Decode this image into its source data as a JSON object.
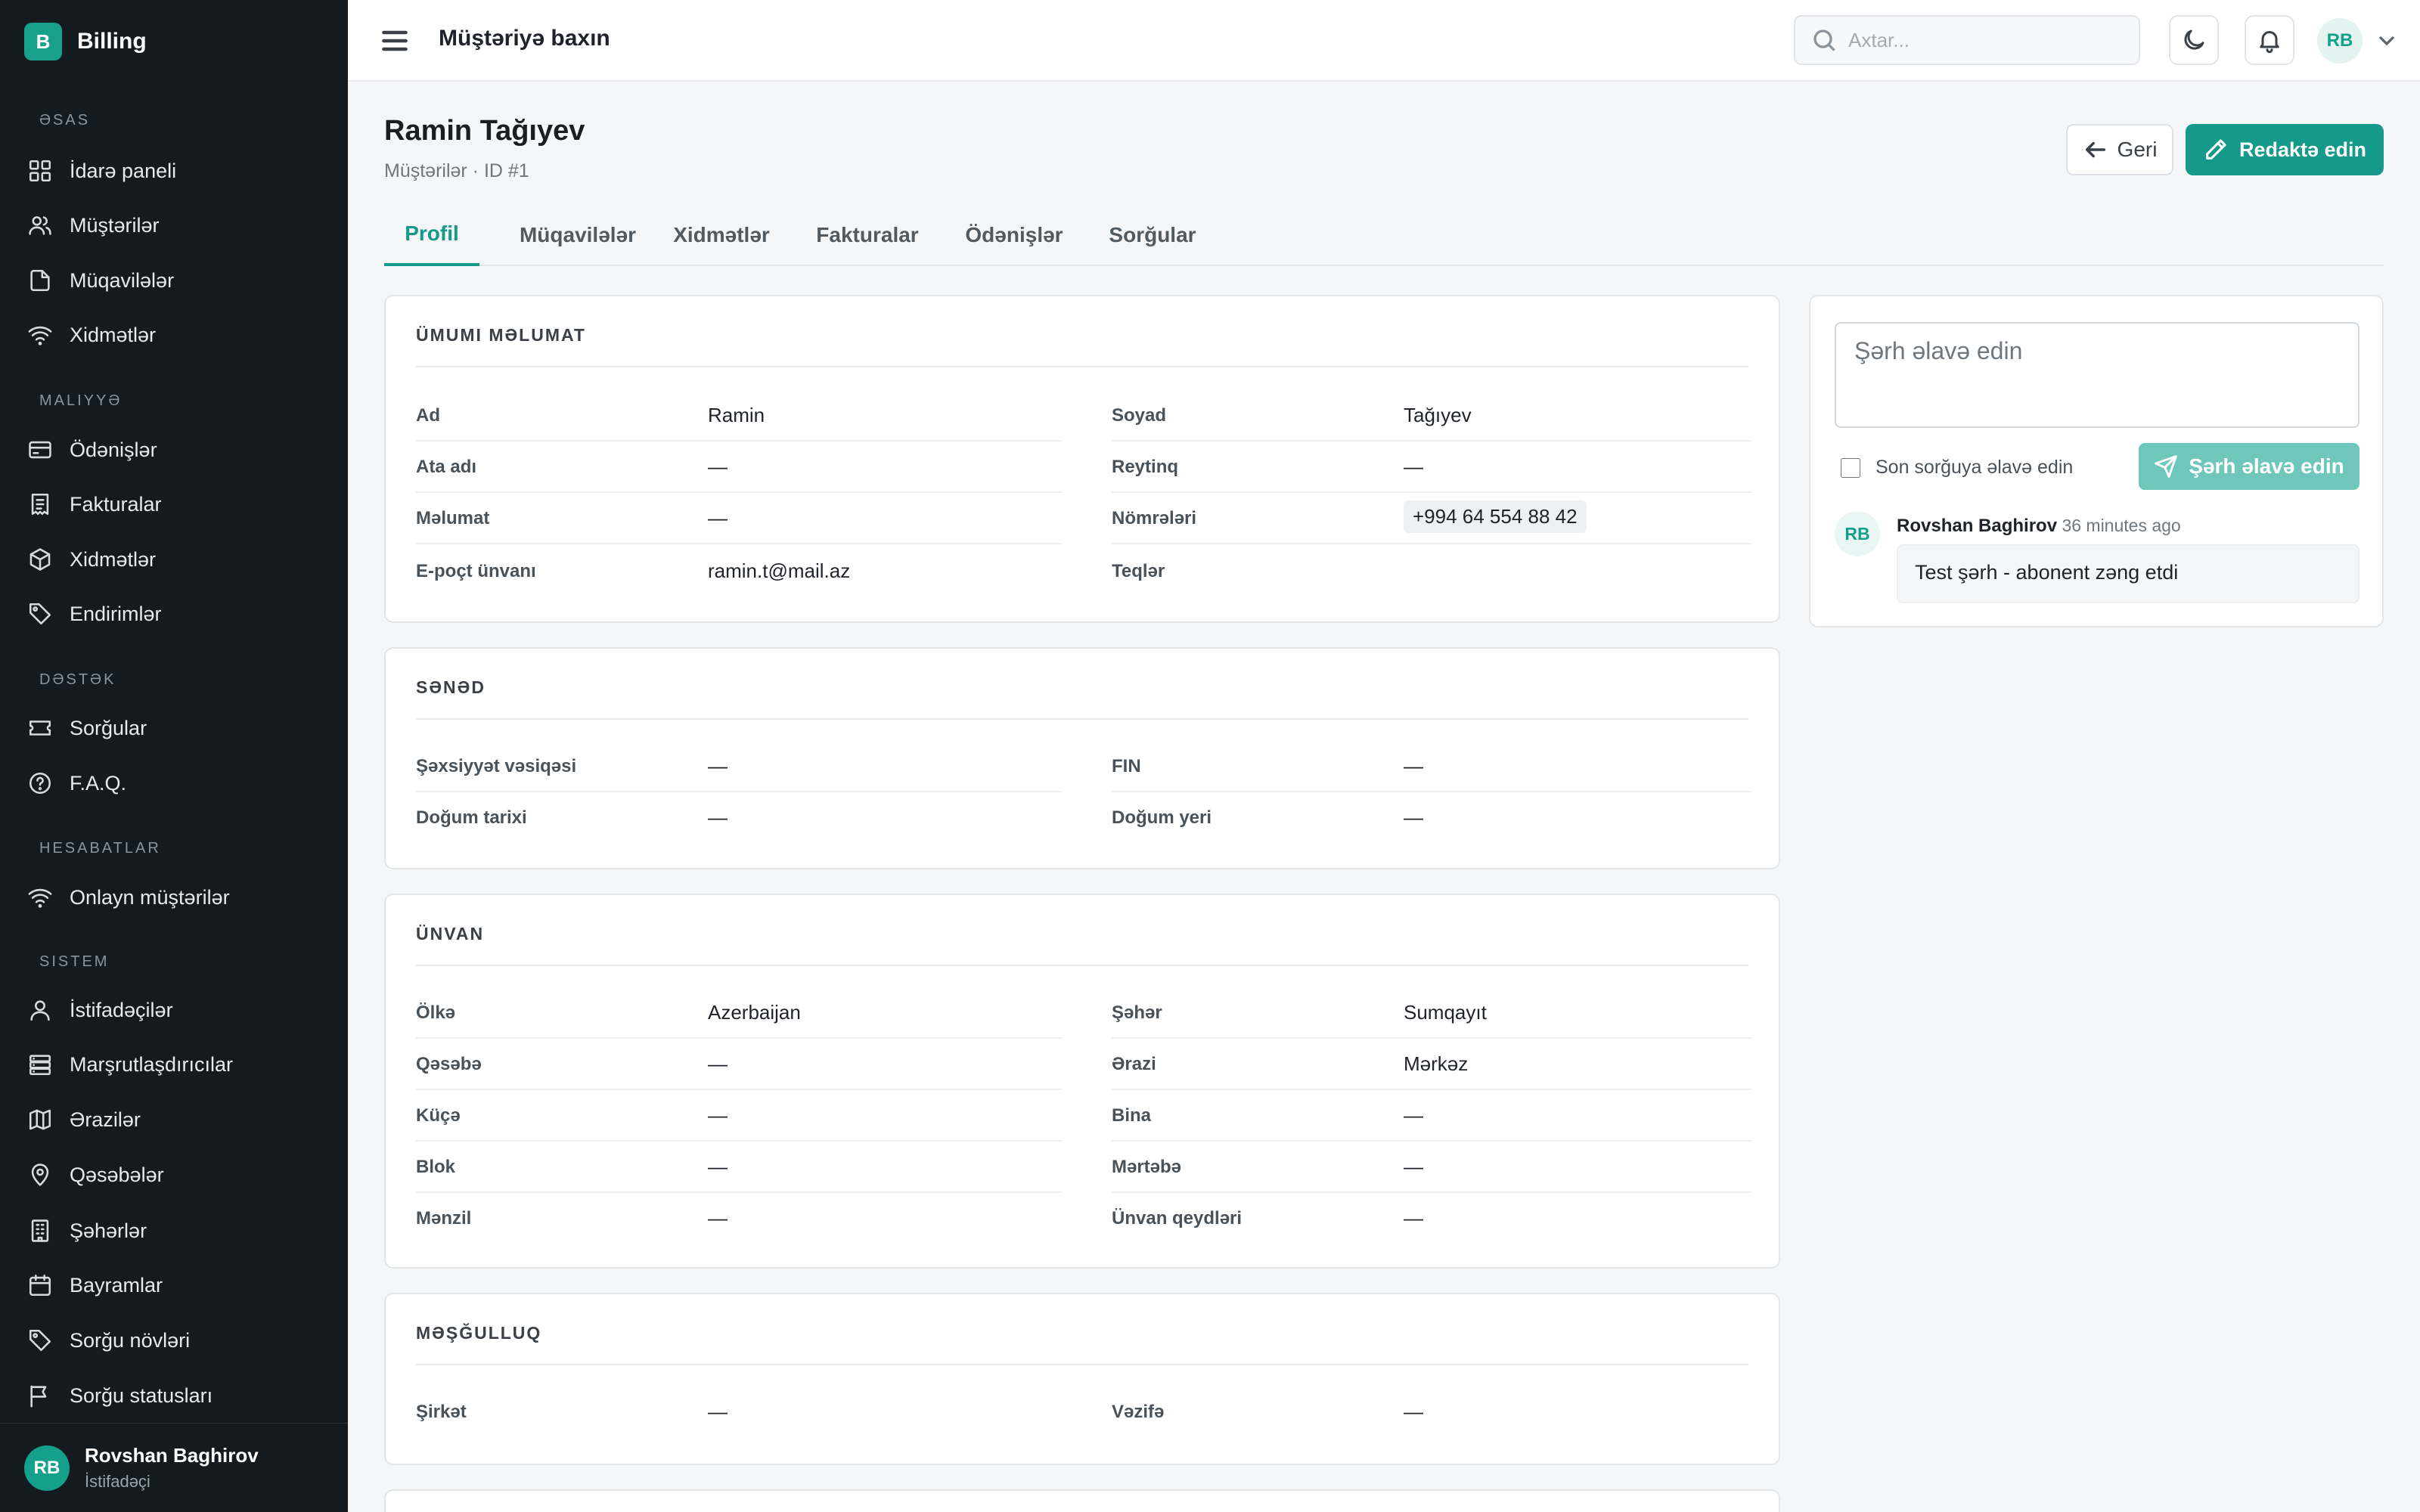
{
  "app": {
    "logo_letter": "B",
    "name": "Billing"
  },
  "sidebar": {
    "sections": {
      "main": "ƏSAS",
      "finance": "MALIYYƏ",
      "support": "DƏSTƏK",
      "accounts": "HESABATLAR",
      "system": "SISTEM"
    },
    "items": [
      {
        "label": "İdarə paneli",
        "icon": "dashboard-icon"
      },
      {
        "label": "Müştərilər",
        "icon": "users-icon"
      },
      {
        "label": "Müqavilələr",
        "icon": "file-icon"
      },
      {
        "label": "Xidmətlər",
        "icon": "wifi-icon"
      },
      {
        "label": "Ödənişlər",
        "icon": "credit-card-icon"
      },
      {
        "label": "Fakturalar",
        "icon": "receipt-icon"
      },
      {
        "label": "Xidmətlər",
        "icon": "box-icon"
      },
      {
        "label": "Endirimlər",
        "icon": "tag-icon"
      },
      {
        "label": "Sorğular",
        "icon": "ticket-icon"
      },
      {
        "label": "F.A.Q.",
        "icon": "help-circle-icon"
      },
      {
        "label": "Onlayn müştərilər",
        "icon": "wifi-icon"
      },
      {
        "label": "İstifadəçilər",
        "icon": "user-icon"
      },
      {
        "label": "Marşrutlaşdırıcılar",
        "icon": "server-icon"
      },
      {
        "label": "Ərazilər",
        "icon": "map-icon"
      },
      {
        "label": "Qəsəbələr",
        "icon": "map-pin-icon"
      },
      {
        "label": "Şəhərlər",
        "icon": "building-icon"
      },
      {
        "label": "Bayramlar",
        "icon": "calendar-icon"
      },
      {
        "label": "Sorğu növləri",
        "icon": "tag-icon"
      },
      {
        "label": "Sorğu statusları",
        "icon": "flag-icon"
      }
    ],
    "user": {
      "initials": "RB",
      "name": "Rovshan Baghirov",
      "role": "İstifadəçi"
    }
  },
  "topbar": {
    "title": "Müştəriyə baxın",
    "search_placeholder": "Axtar...",
    "avatar_initials": "RB"
  },
  "page": {
    "title": "Ramin Tağıyev",
    "breadcrumb": "Müştərilər · ID #1",
    "back_label": "Geri",
    "edit_label": "Redaktə edin"
  },
  "tabs": [
    "Profil",
    "Müqavilələr",
    "Xidmətlər",
    "Fakturalar",
    "Ödənişlər",
    "Sorğular"
  ],
  "cards": {
    "general": {
      "title": "ÜMUMI MƏLUMAT",
      "rows": [
        {
          "k1": "Ad",
          "v1": "Ramin",
          "k2": "Soyad",
          "v2": "Tağıyev"
        },
        {
          "k1": "Ata adı",
          "v1": "—",
          "k2": "Reytinq",
          "v2": "—"
        },
        {
          "k1": "Məlumat",
          "v1": "—",
          "k2": "Nömrələri",
          "v2": "+994 64 554 88 42"
        },
        {
          "k1": "E-poçt ünvanı",
          "v1": "ramin.t@mail.az",
          "k2": "Teqlər",
          "v2": ""
        }
      ]
    },
    "document": {
      "title": "SƏNƏD",
      "rows": [
        {
          "k1": "Şəxsiyyət vəsiqəsi",
          "v1": "—",
          "k2": "FIN",
          "v2": "—"
        },
        {
          "k1": "Doğum tarixi",
          "v1": "—",
          "k2": "Doğum yeri",
          "v2": "—"
        }
      ]
    },
    "address": {
      "title": "ÜNVAN",
      "rows": [
        {
          "k1": "Ölkə",
          "v1": "Azerbaijan",
          "k2": "Şəhər",
          "v2": "Sumqayıt"
        },
        {
          "k1": "Qəsəbə",
          "v1": "—",
          "k2": "Ərazi",
          "v2": "Mərkəz"
        },
        {
          "k1": "Küçə",
          "v1": "—",
          "k2": "Bina",
          "v2": "—"
        },
        {
          "k1": "Blok",
          "v1": "—",
          "k2": "Mərtəbə",
          "v2": "—"
        },
        {
          "k1": "Mənzil",
          "v1": "—",
          "k2": "Ünvan qeydləri",
          "v2": "—"
        }
      ]
    },
    "employment": {
      "title": "MƏŞĞULLUQ",
      "rows": [
        {
          "k1": "Şirkət",
          "v1": "—",
          "k2": "Vəzifə",
          "v2": "—"
        }
      ]
    }
  },
  "comments": {
    "placeholder": "Şərh əlavə edin",
    "checkbox_label": "Son sorğuya əlavə edin",
    "submit_label": "Şərh əlavə edin",
    "items": [
      {
        "initials": "RB",
        "author": "Rovshan Baghirov",
        "time": "36 minutes ago",
        "text": "Test şərh - abonent zəng etdi"
      }
    ]
  },
  "colors": {
    "accent": "#14998a",
    "sidebar_bg": "#141b20",
    "page_bg": "#f5f6f7"
  }
}
